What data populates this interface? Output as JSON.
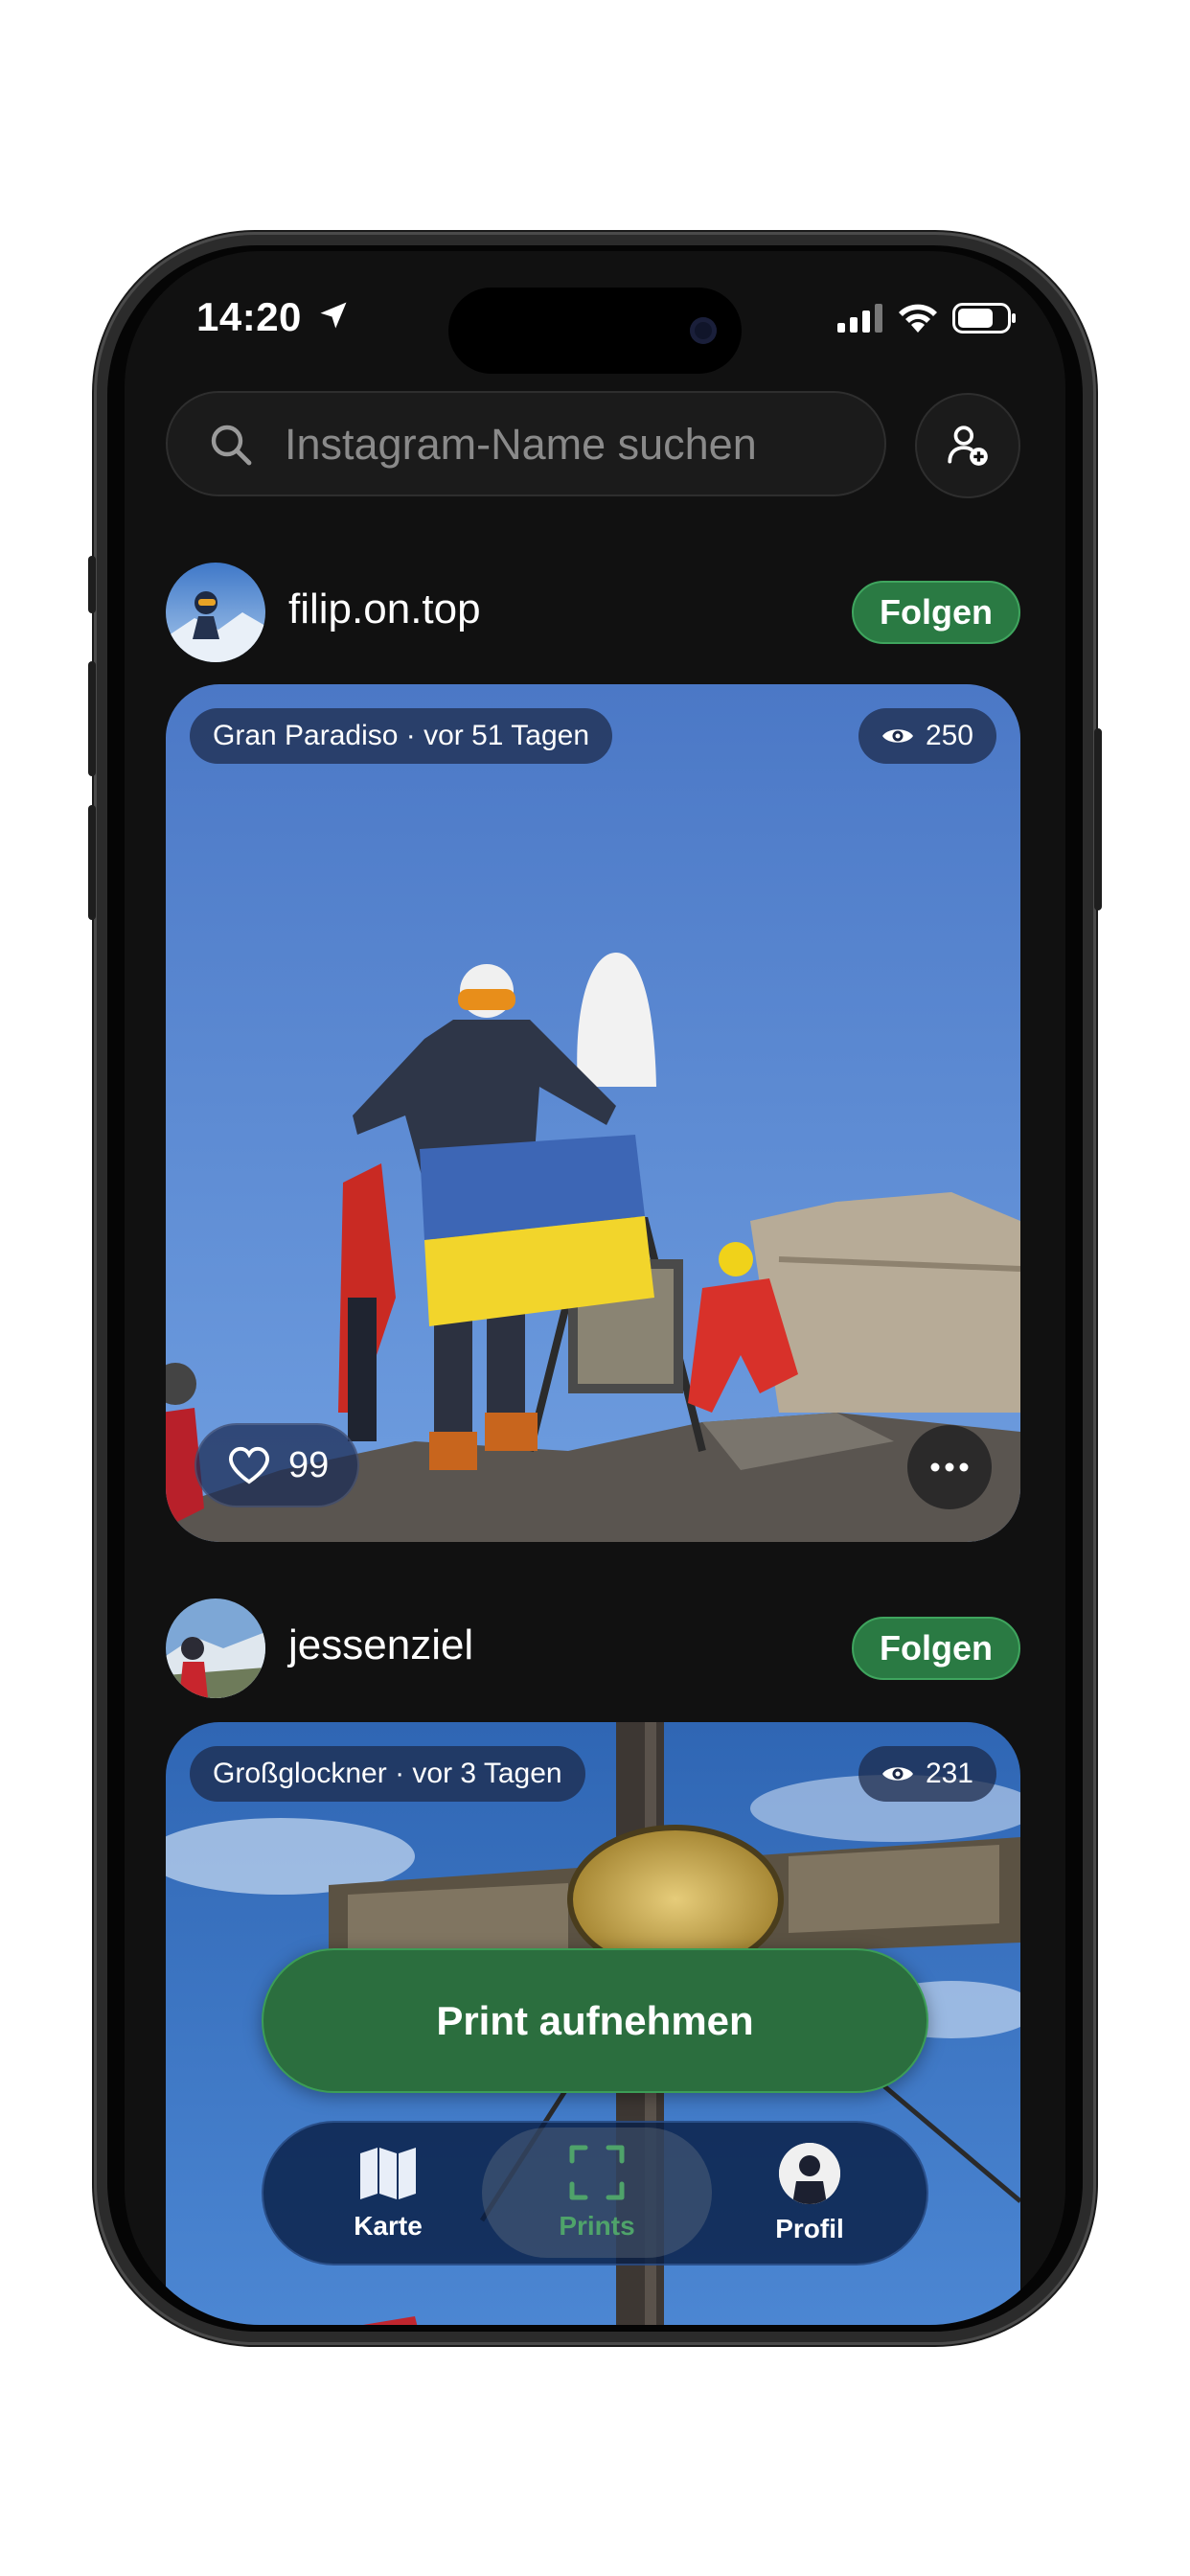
{
  "status_bar": {
    "time": "14:20"
  },
  "search": {
    "placeholder": "Instagram-Name suchen"
  },
  "posts": [
    {
      "username": "filip.on.top",
      "follow_label": "Folgen",
      "location_time": "Gran Paradiso · vor 51 Tagen",
      "views": "250",
      "likes": "99"
    },
    {
      "username": "jessenziel",
      "follow_label": "Folgen",
      "location_time": "Großglockner · vor 3 Tagen",
      "views": "231"
    }
  ],
  "print_button": {
    "label": "Print aufnehmen"
  },
  "tabbar": {
    "items": [
      {
        "label": "Karte",
        "icon": "map-icon"
      },
      {
        "label": "Prints",
        "icon": "scan-icon",
        "active": true
      },
      {
        "label": "Profil",
        "icon": "avatar"
      }
    ]
  },
  "colors": {
    "accent_green": "#2b6e3e",
    "background": "#111111"
  }
}
